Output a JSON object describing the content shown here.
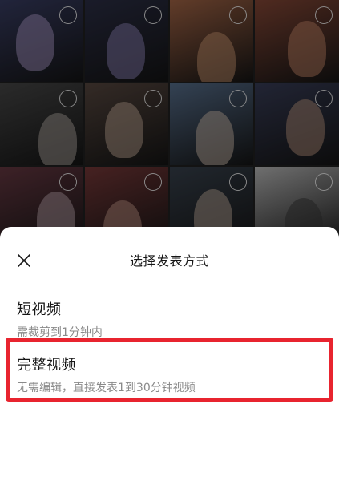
{
  "gallery": {
    "tiles": [
      {
        "bg": "#3a3f66",
        "accent": "#b9a6d8"
      },
      {
        "bg": "#2d3048",
        "accent": "#9a8fc8"
      },
      {
        "bg": "#a86848",
        "accent": "#d8a078"
      },
      {
        "bg": "#8a4a38",
        "accent": "#d49070"
      },
      {
        "bg": "#4a4a4a",
        "accent": "#bfb6ae"
      },
      {
        "bg": "#5a4a42",
        "accent": "#d2b6a2"
      },
      {
        "bg": "#5a7290",
        "accent": "#dcc8b8"
      },
      {
        "bg": "#3a3f5a",
        "accent": "#c8a088"
      },
      {
        "bg": "#6a3a44",
        "accent": "#c8b0b8"
      },
      {
        "bg": "#7a3a3a",
        "accent": "#d0a090"
      },
      {
        "bg": "#3a4450",
        "accent": "#cdb8a8"
      },
      {
        "bg": "#c0c0c0",
        "accent": "#3a3a3a"
      }
    ]
  },
  "sheet": {
    "title": "选择发表方式",
    "close_icon": "close-icon",
    "options": [
      {
        "title": "短视频",
        "desc": "需裁剪到1分钟内"
      },
      {
        "title": "完整视频",
        "desc": "无需编辑，直接发表1到30分钟视频"
      }
    ],
    "highlight_color": "#e8242f"
  }
}
